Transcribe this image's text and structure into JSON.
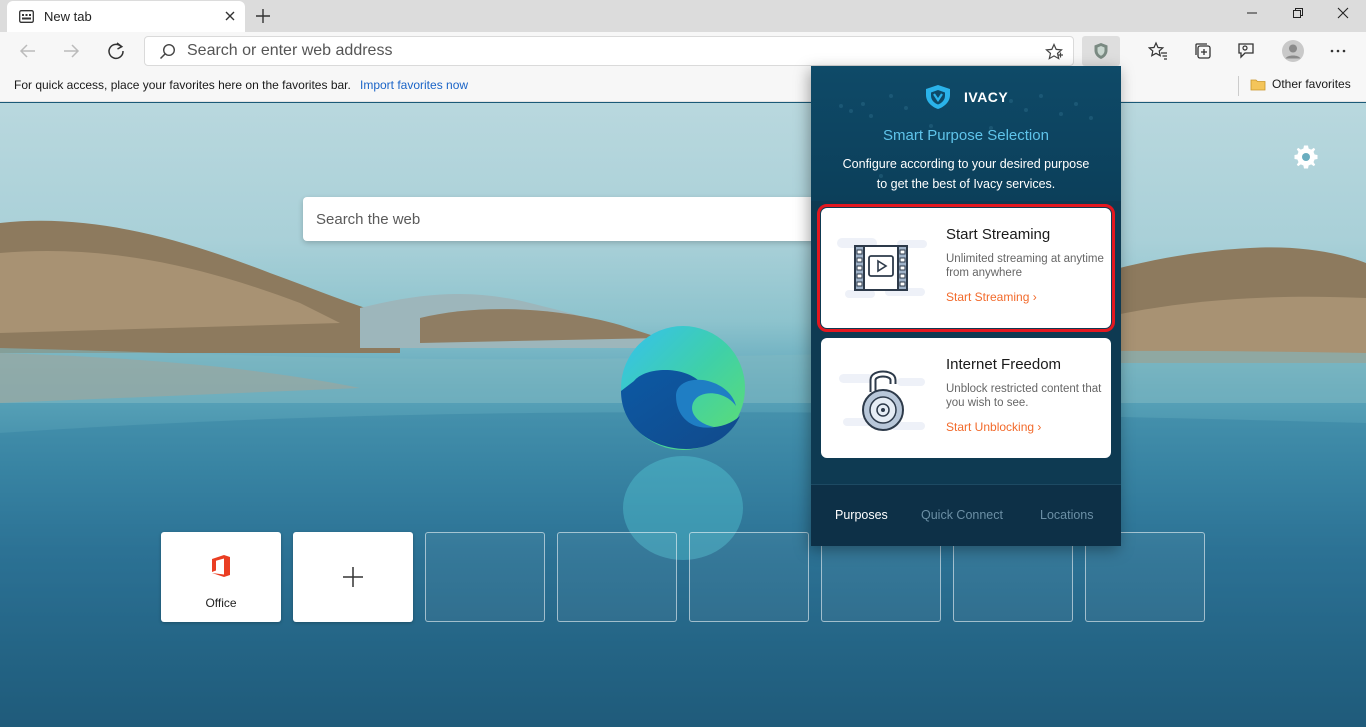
{
  "browser": {
    "tab_title": "New tab",
    "address_placeholder": "Search or enter web address"
  },
  "favorites_bar": {
    "hint_text": "For quick access, place your favorites here on the favorites bar.",
    "import_link": "Import favorites now",
    "other_favorites": "Other favorites"
  },
  "newtab": {
    "search_placeholder": "Search the web",
    "tiles": [
      {
        "label": "Office",
        "type": "site"
      },
      {
        "label": "",
        "type": "add"
      },
      {
        "label": "",
        "type": "empty"
      },
      {
        "label": "",
        "type": "empty"
      },
      {
        "label": "",
        "type": "empty"
      },
      {
        "label": "",
        "type": "empty"
      },
      {
        "label": "",
        "type": "empty"
      },
      {
        "label": "",
        "type": "empty"
      }
    ]
  },
  "ivacy": {
    "brand": "IVACY",
    "heading": "Smart Purpose Selection",
    "description": "Configure according to your desired purpose to get the best of Ivacy services.",
    "cards": [
      {
        "title": "Start Streaming",
        "description": "Unlimited streaming at anytime from anywhere",
        "link": "Start Streaming",
        "highlighted": true
      },
      {
        "title": "Internet Freedom",
        "description": "Unblock restricted content that you wish to see.",
        "link": "Start Unblocking",
        "highlighted": false
      }
    ],
    "footer_tabs": [
      {
        "label": "Purposes",
        "active": true
      },
      {
        "label": "Quick Connect",
        "active": false
      },
      {
        "label": "Locations",
        "active": false
      }
    ]
  },
  "colors": {
    "accent_link": "#1a64c7",
    "ivacy_heading": "#5fc4ea",
    "ivacy_link": "#f26a2b",
    "highlight": "#e4171f"
  }
}
